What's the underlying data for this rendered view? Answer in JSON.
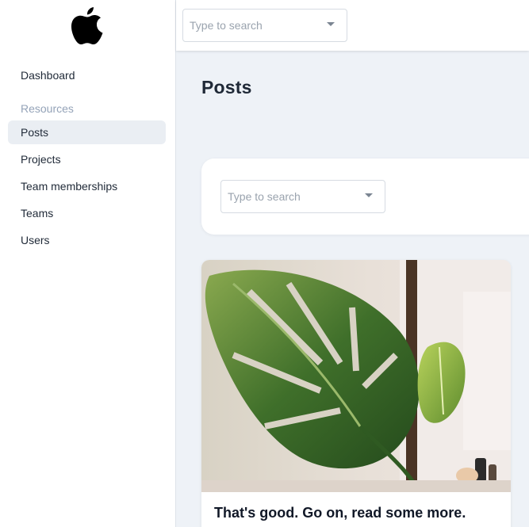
{
  "sidebar": {
    "logo": "apple-logo",
    "dashboard_label": "Dashboard",
    "section_label": "Resources",
    "items": [
      {
        "label": "Posts",
        "active": true
      },
      {
        "label": "Projects",
        "active": false
      },
      {
        "label": "Team memberships",
        "active": false
      },
      {
        "label": "Teams",
        "active": false
      },
      {
        "label": "Users",
        "active": false
      }
    ]
  },
  "header": {
    "search": {
      "placeholder": "Type to search"
    }
  },
  "main": {
    "title": "Posts",
    "filter": {
      "search_placeholder": "Type to search"
    },
    "cards": [
      {
        "image": "monstera-leaf-photo",
        "title": "That's good. Go on, read some more."
      }
    ]
  },
  "colors": {
    "background": "#eef2f7",
    "sidebar_active": "#eaeef3",
    "muted_text": "#94a3b8"
  }
}
